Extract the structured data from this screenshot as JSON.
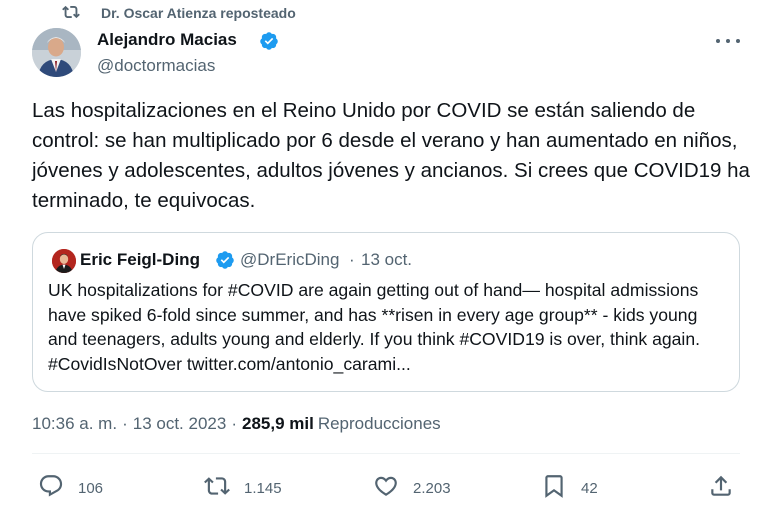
{
  "repost": {
    "icon": "retweet-icon",
    "text": "Dr. Oscar Atienza reposteado"
  },
  "author": {
    "name": "Alejandro Macias",
    "handle": "@doctormacias",
    "verified": true
  },
  "tweet": {
    "text": "Las hospitalizaciones en el Reino Unido por COVID se están saliendo de control: se han multiplicado por 6 desde el verano y han aumentado en niños, jóvenes y adolescentes, adultos jóvenes y ancianos. Si crees que COVID19 ha terminado, te equivocas."
  },
  "quote": {
    "name": "Eric Feigl-Ding",
    "handle": "@DrEricDing",
    "dot": "·",
    "date": "13 oct.",
    "verified": true,
    "text": "UK hospitalizations for #COVID are again getting out of hand— hospital admissions have spiked 6-fold since summer, and has **risen in every age group** - kids young and teenagers, adults young and elderly. If you think #COVID19 is over, think again. #CovidIsNotOver twitter.com/antonio_carami..."
  },
  "meta": {
    "time": "10:36 a. m.",
    "sep1": "·",
    "date": "13 oct. 2023",
    "sep2": "·",
    "views": "285,9 mil",
    "views_label": "Reproducciones"
  },
  "actions": {
    "replies": "106",
    "reposts": "1.145",
    "likes": "2.203",
    "bookmarks": "42"
  },
  "colors": {
    "text": "#0f1419",
    "secondary": "#536471",
    "verified": "#1d9bf0",
    "border": "#cfd9de"
  }
}
